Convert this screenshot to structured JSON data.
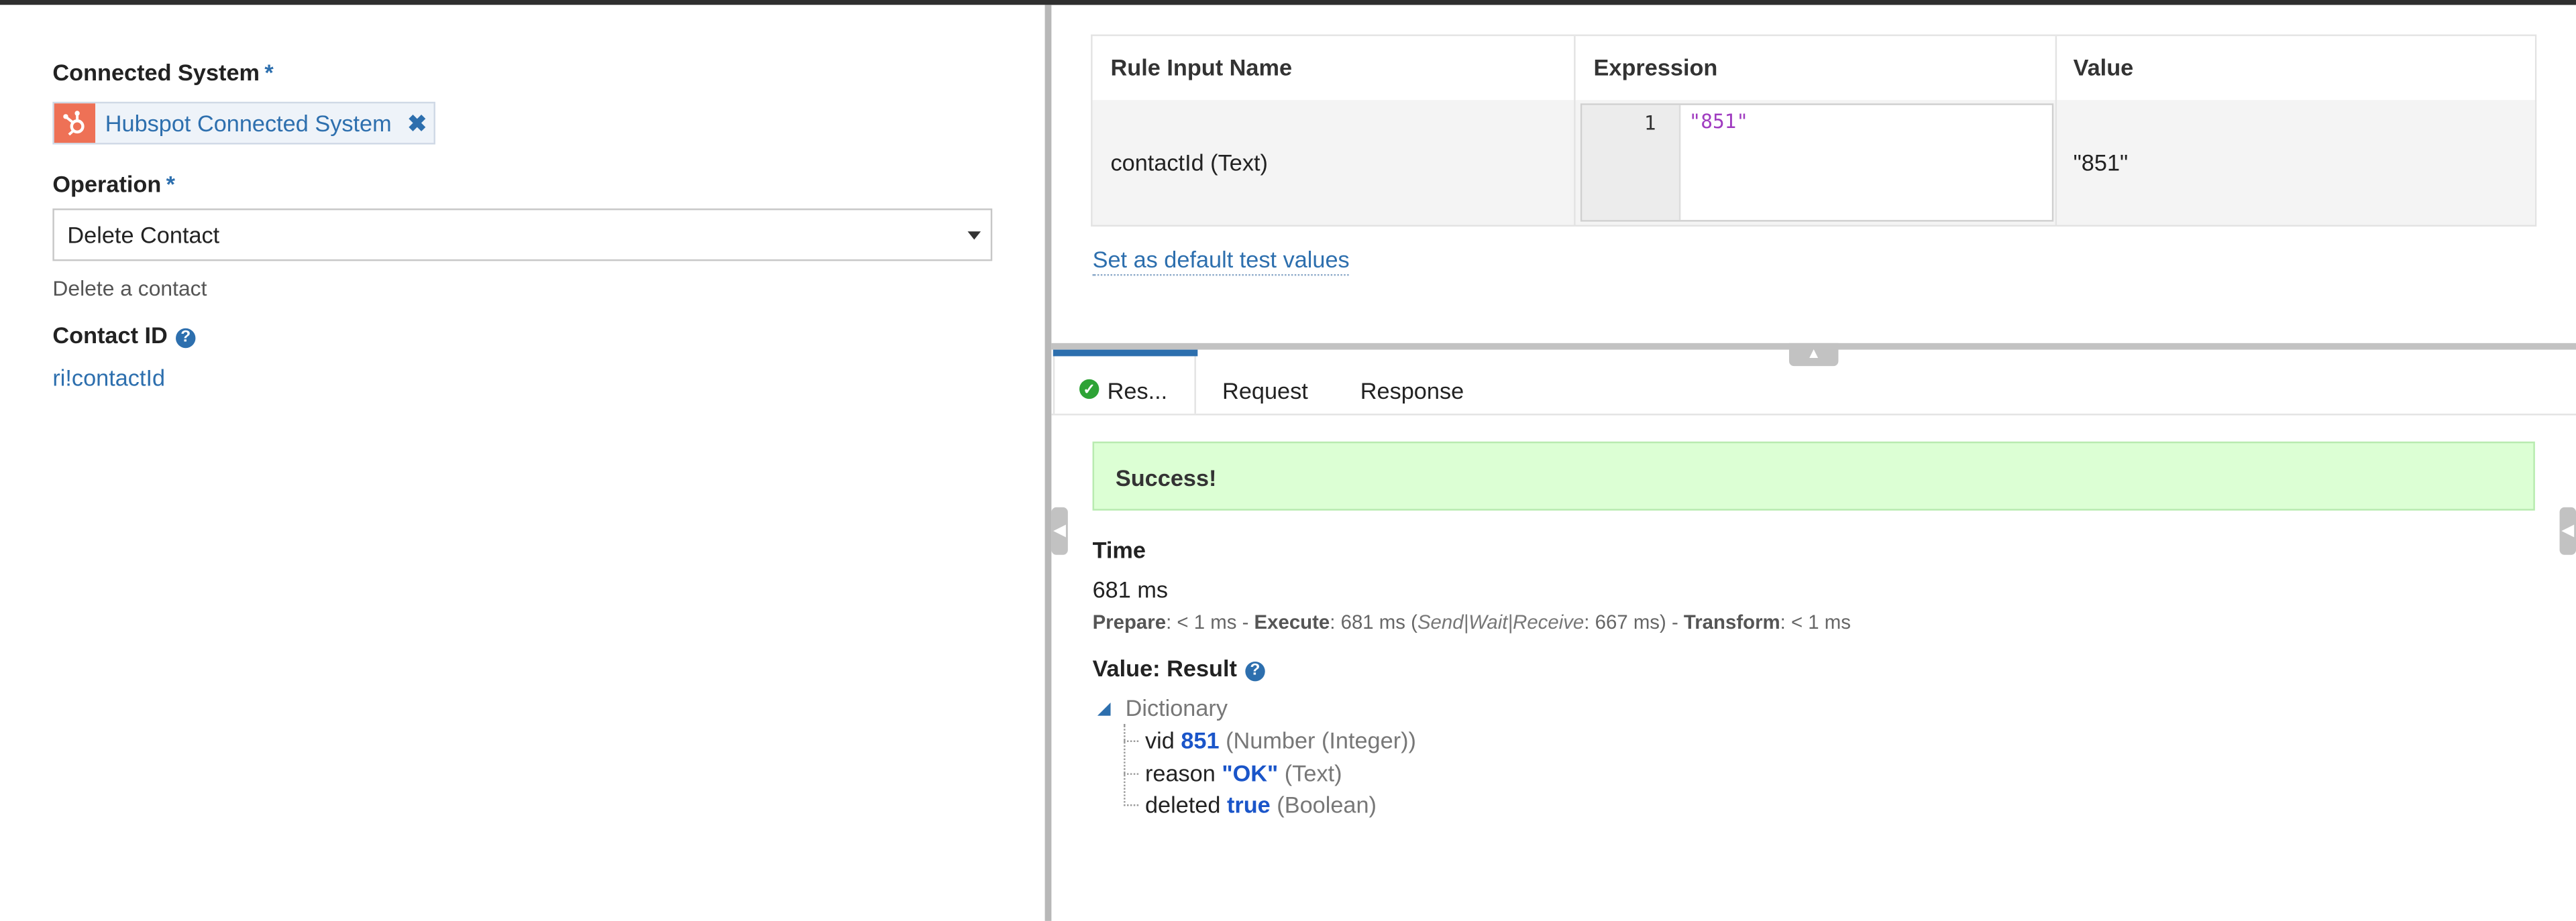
{
  "left_panel": {
    "connected_system_label": "Connected System",
    "required_marker": "*",
    "connected_system_value": "Hubspot Connected System",
    "remove_icon": "✖",
    "operation_label": "Operation",
    "operation_value": "Delete Contact",
    "operation_description": "Delete a contact",
    "contact_id_label": "Contact ID",
    "help_icon": "?",
    "contact_id_value": "ri!contactId"
  },
  "rule_inputs": {
    "headers": [
      "Rule Input Name",
      "Expression",
      "Value"
    ],
    "row": {
      "name": "contactId (Text)",
      "line_number": "1",
      "expression": "\"851\"",
      "value": "\"851\""
    },
    "default_link": "Set as default test values"
  },
  "tabs": {
    "result": "Res...",
    "request": "Request",
    "response": "Response"
  },
  "result": {
    "status": "Success!",
    "time_label": "Time",
    "time_value": "681 ms",
    "breakdown": {
      "prepare_label": "Prepare",
      "prepare_value": ": < 1 ms - ",
      "execute_label": "Execute",
      "execute_value": ": 681 ms (",
      "send_label": "Send|Wait|Receive",
      "send_value": ": 667 ms) - ",
      "transform_label": "Transform",
      "transform_value": ": < 1 ms"
    },
    "value_label": "Value: Result",
    "tree_root": "Dictionary",
    "fields": [
      {
        "key": "vid",
        "value": "851",
        "type": "(Number (Integer))"
      },
      {
        "key": "reason",
        "value": "\"OK\"",
        "type": "(Text)"
      },
      {
        "key": "deleted",
        "value": "true",
        "type": "(Boolean)"
      }
    ]
  },
  "colors": {
    "accent": "#2d6fae",
    "success_bg": "#dcffd4",
    "hubspot": "#ee7156"
  }
}
